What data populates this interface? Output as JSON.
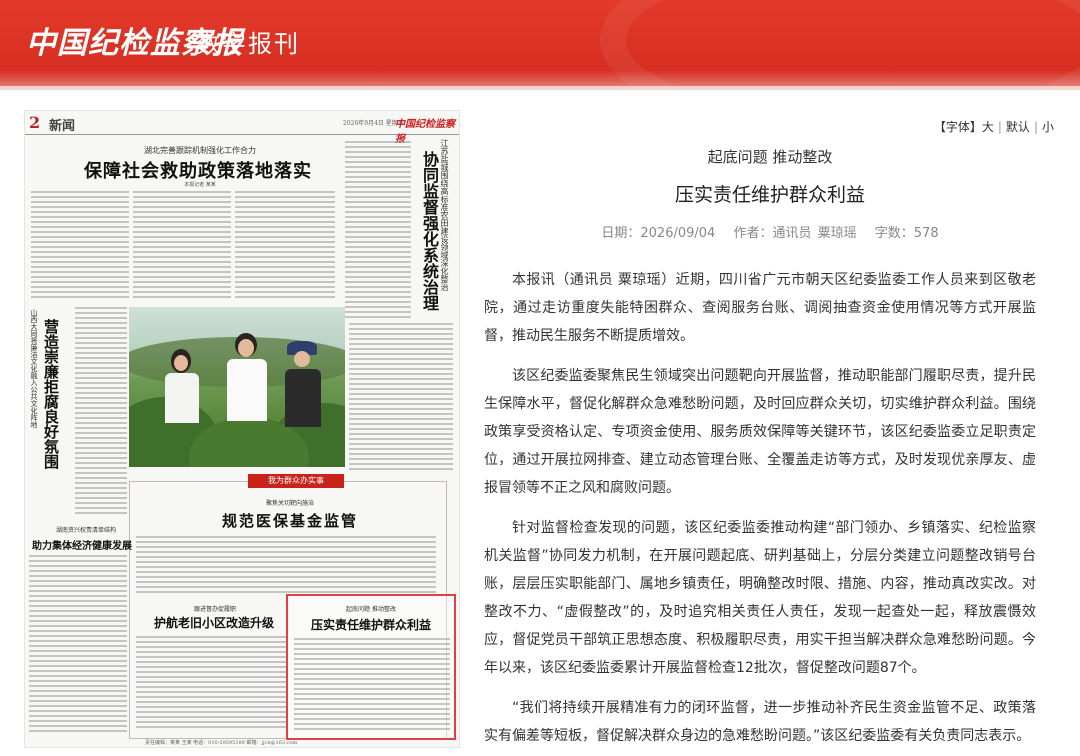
{
  "header": {
    "brand": "中国纪检监察报",
    "subtitle": "数字报刊"
  },
  "paper": {
    "page_number": "2",
    "section": "新闻",
    "date": "2026年9月4日 星期五",
    "masthead": "中国纪检监察报",
    "lead_kicker": "湖北完善跟踪机制强化工作合力",
    "lead_title": "保障社会救助政策落地落实",
    "lead_byline": "本报记者 某某",
    "right_kicker": "江苏盐城围绕高标准农田建设领域深化整治",
    "right_title": "协同监督强化系统治理",
    "left_kicker": "山西大同将廉洁文化融入公共文化阵地",
    "left_title": "营造崇廉拒腐良好氛围",
    "box_banner": "我为群众办实事",
    "box_kicker": "聚焦关切靶向施治",
    "box_title": "规范医保基金监管",
    "lower_left_kicker": "湖南资兴权责清单结构",
    "lower_left_title": "助力集体经济健康发展",
    "mid_kicker": "跟进督办促履职",
    "mid_title": "护航老旧小区改造升级",
    "highlight_kicker": "起底问题 推动整改",
    "highlight_title": "压实责任维护群众利益",
    "footer": "责任编辑：某某 王某 电话：010-59595189 邮箱：jjcb@163.com"
  },
  "font_control": {
    "label": "【字体】",
    "large": "大",
    "default": "默认",
    "small": "小",
    "separator": "|"
  },
  "article": {
    "kicker": "起底问题 推动整改",
    "title": "压实责任维护群众利益",
    "date_label": "日期：",
    "date": "2026/09/04",
    "author_label": "作者：",
    "author": "通讯员 粟琼瑶",
    "wordcount_label": "字数：",
    "wordcount": "578",
    "paragraphs": [
      "本报讯（通讯员 粟琼瑶）近期，四川省广元市朝天区纪委监委工作人员来到区敬老院，通过走访重度失能特困群众、查阅服务台账、调阅抽查资金使用情况等方式开展监督，推动民生服务不断提质增效。",
      "该区纪委监委聚焦民生领域突出问题靶向开展监督，推动职能部门履职尽责，提升民生保障水平，督促化解群众急难愁盼问题，及时回应群众关切，切实维护群众利益。围绕政策享受资格认定、专项资金使用、服务质效保障等关键环节，该区纪委监委立足职责定位，通过开展拉网排查、建立动态管理台账、全覆盖走访等方式，及时发现优亲厚友、虚报冒领等不正之风和腐败问题。",
      "针对监督检查发现的问题，该区纪委监委推动构建“部门领办、乡镇落实、纪检监察机关监督”协同发力机制，在开展问题起底、研判基础上，分层分类建立问题整改销号台账，层层压实职能部门、属地乡镇责任，明确整改时限、措施、内容，推动真改实改。对整改不力、“虚假整改”的，及时追究相关责任人责任，发现一起查处一起，释放震慑效应，督促党员干部筑正思想态度、积极履职尽责，用实干担当解决群众急难愁盼问题。今年以来，该区纪委监委累计开展监督检查12批次，督促整改问题87个。",
      "“我们将持续开展精准有力的闭环监督，进一步推动补齐民生资金监管不足、政策落实有偏差等短板，督促解决群众身边的急难愁盼问题。”该区纪委监委有关负责同志表示。"
    ]
  },
  "colors": {
    "header_red": "#d42b1f",
    "highlight_border": "#e23f3f",
    "banner_red": "#c8231b"
  }
}
